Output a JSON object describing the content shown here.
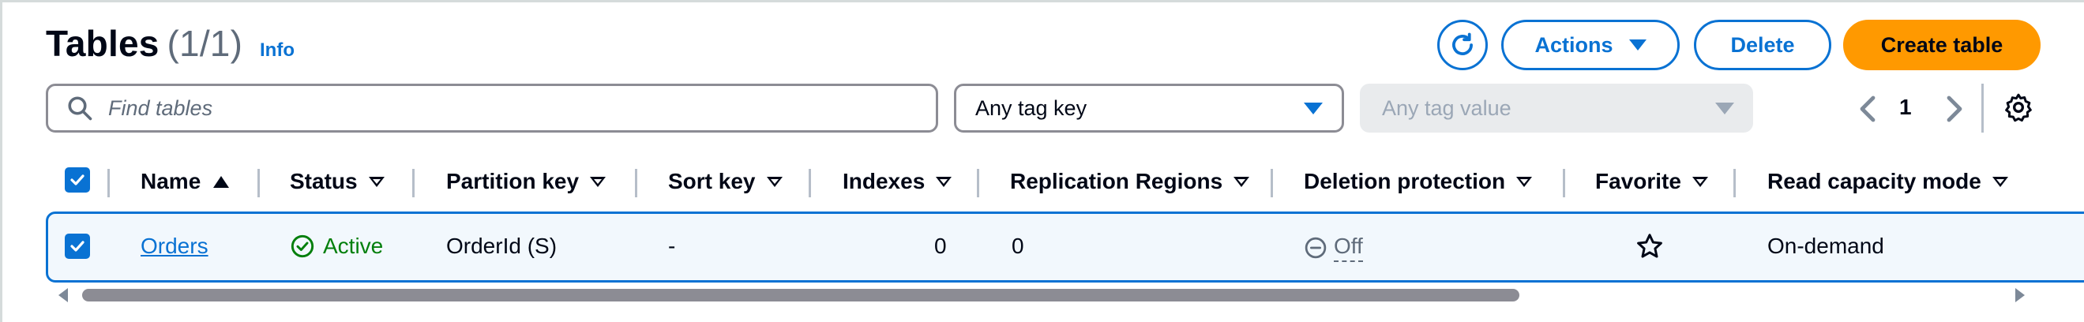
{
  "header": {
    "title": "Tables",
    "count": "(1/1)",
    "info": "Info",
    "refresh_icon": "refresh-icon",
    "actions_label": "Actions",
    "delete_label": "Delete",
    "create_label": "Create table",
    "accent_color": "#0972d3",
    "primary_color": "#ff9900"
  },
  "filters": {
    "search_placeholder": "Find tables",
    "tag_key": "Any tag key",
    "tag_value": "Any tag value"
  },
  "pagination": {
    "current_page": "1"
  },
  "table": {
    "columns": [
      "Name",
      "Status",
      "Partition key",
      "Sort key",
      "Indexes",
      "Replication Regions",
      "Deletion protection",
      "Favorite",
      "Read capacity mode"
    ],
    "rows": [
      {
        "name": "Orders",
        "status": "Active",
        "partition_key": "OrderId (S)",
        "sort_key": "-",
        "indexes": "0",
        "replication_regions": "0",
        "deletion_protection": "Off",
        "favorite": "star-outline",
        "read_capacity_mode": "On-demand"
      }
    ]
  }
}
